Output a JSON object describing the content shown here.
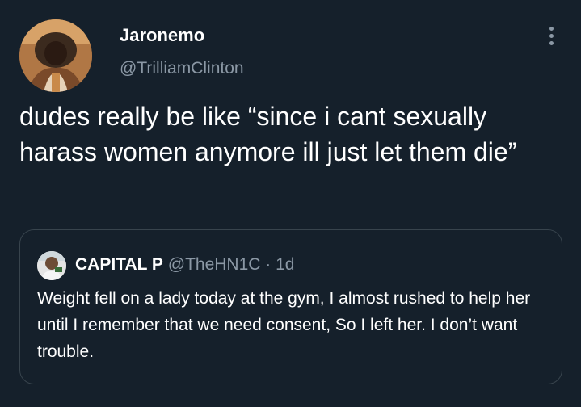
{
  "tweet": {
    "author": {
      "display_name": "Jaronemo",
      "handle": "@TrilliamClinton",
      "avatar": "profile-photo"
    },
    "more_icon": "more-vertical-icon",
    "text": "dudes really be like “since i cant sexually harass women anymore ill just let them die”",
    "quote": {
      "author": {
        "display_name": "CAPITAL P",
        "handle": "@TheHN1C",
        "avatar": "profile-photo"
      },
      "separator": "·",
      "time": "1d",
      "text": "Weight fell on a lady today at the gym, I almost rushed to help her until I remember that we need consent, So I left her. I don’t want trouble."
    }
  },
  "colors": {
    "background": "#15202b",
    "primary_text": "#ffffff",
    "secondary_text": "#8b98a5",
    "border": "#38444d"
  }
}
